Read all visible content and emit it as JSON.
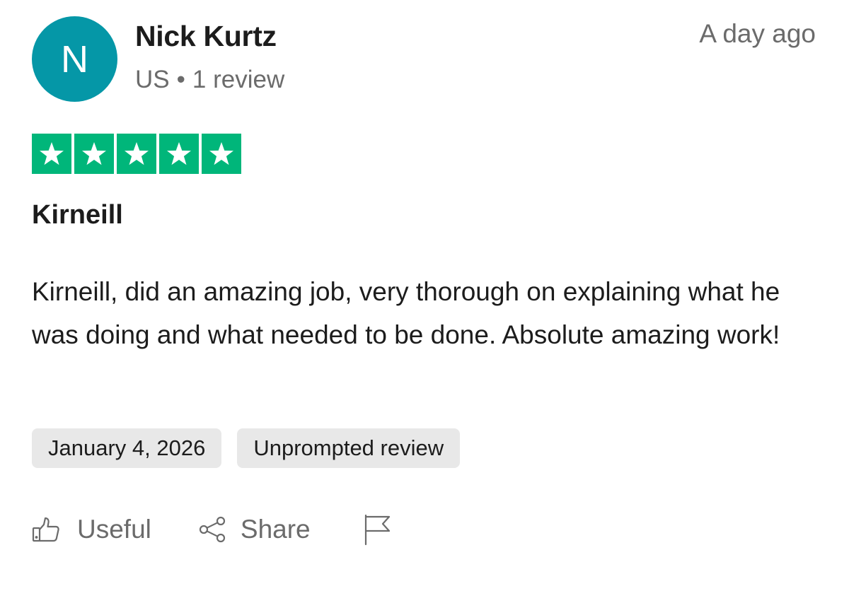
{
  "reviewer": {
    "initial": "N",
    "name": "Nick Kurtz",
    "country": "US",
    "separator": "•",
    "review_count": "1 review",
    "avatar_color": "#0597a7"
  },
  "posted": "A day ago",
  "rating": {
    "stars": 5,
    "max": 5,
    "color": "#00b67a"
  },
  "review": {
    "title": "Kirneill",
    "body": "Kirneill, did an amazing job, very thorough on explaining what he was doing and what needed to be done. Absolute amazing work!"
  },
  "tags": {
    "date": "January 4, 2026",
    "type": "Unprompted review"
  },
  "actions": {
    "useful_label": "Useful",
    "useful_icon": "thumbs-up-icon",
    "share_label": "Share",
    "share_icon": "share-icon",
    "report_icon": "flag-icon"
  }
}
